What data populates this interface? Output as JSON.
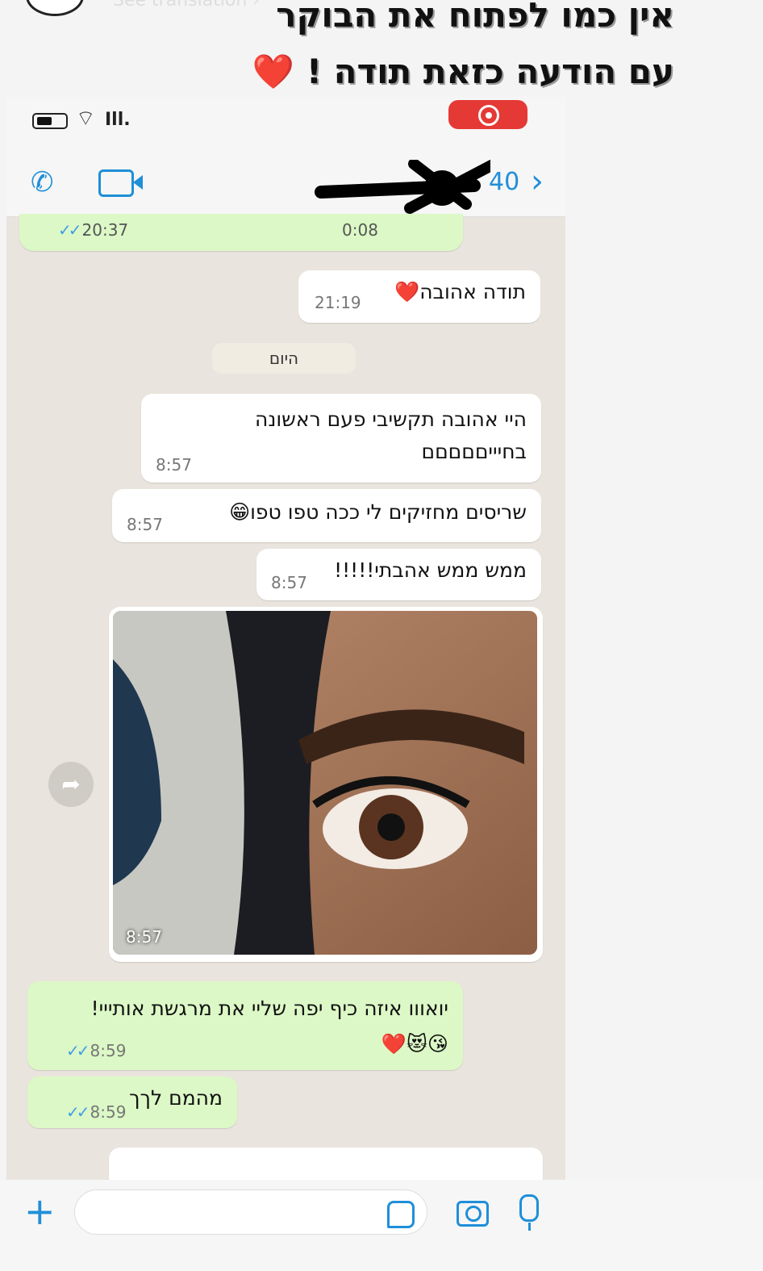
{
  "story": {
    "see_translation": "See translation ›",
    "caption_line1": "אין כמו לפתוח את הבוקר",
    "caption_line2": "עם הודעה כזאת תודה !",
    "caption_heart": "❤️"
  },
  "status_bar": {
    "wifi": "wifi-icon",
    "signal": "signal-icon",
    "battery": "battery-icon",
    "recording_color": "#e53935"
  },
  "header": {
    "back_count": "40",
    "accent_color": "#1f8fd8"
  },
  "messages": [
    {
      "type": "out",
      "time": "20:37",
      "duration": "0:08",
      "status": "read"
    },
    {
      "type": "in",
      "text": "תודה אהובה",
      "emoji": "❤️",
      "time": "21:19"
    },
    {
      "type": "date",
      "text": "היום"
    },
    {
      "type": "in",
      "text": "היי אהובה תקשיבי פעם ראשונה בחיייםםםםם",
      "time": "8:57"
    },
    {
      "type": "in",
      "text": "שריסים מחזיקים לי ככה טפו טפו😁",
      "time": "8:57"
    },
    {
      "type": "in",
      "text": "ממש ממש אהבתי!!!!!",
      "time": "8:57"
    },
    {
      "type": "in-photo",
      "time": "8:57"
    },
    {
      "type": "out",
      "text": "יואווו איזה כיף יפה שליי את מרגשת אותייי!",
      "emoji": "😘😻❤️",
      "time": "8:59",
      "status": "read"
    },
    {
      "type": "out",
      "text": "מהמם לךך",
      "time": "8:59",
      "status": "read"
    }
  ],
  "composer": {
    "placeholder": ""
  }
}
